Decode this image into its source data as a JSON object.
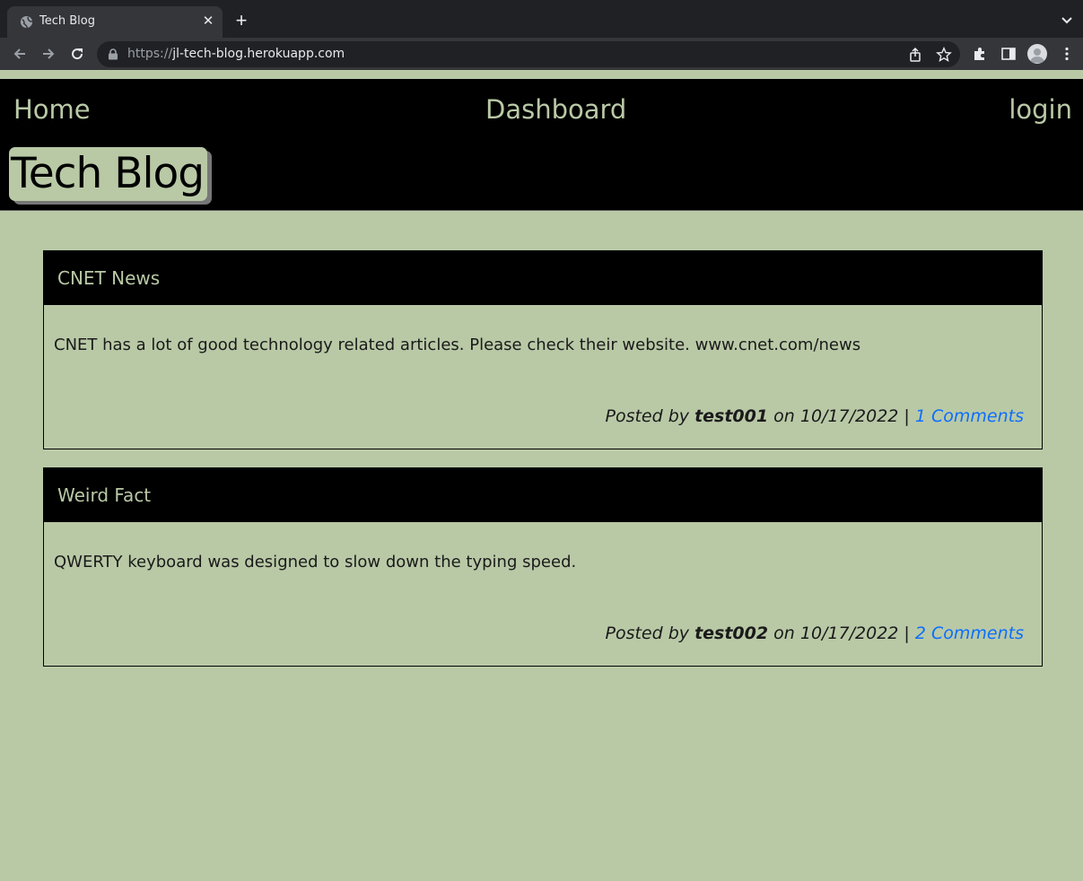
{
  "browser": {
    "tab_title": "Tech Blog",
    "url_scheme": "https://",
    "url_host": "jl-tech-blog.herokuapp.com"
  },
  "site": {
    "nav": {
      "home": "Home",
      "dashboard": "Dashboard",
      "login": "login"
    },
    "brand": "Tech Blog",
    "colors": {
      "accent": "#b9c9a6",
      "header_bg": "#000000",
      "link": "#0d6efd"
    }
  },
  "posts": [
    {
      "title": "CNET News",
      "body": "CNET has a lot of good technology related articles. Please check their website. www.cnet.com/news",
      "posted_by_label": "Posted by",
      "author": "test001",
      "on_label": "on",
      "date": "10/17/2022",
      "separator": "|",
      "comments": "1 Comments"
    },
    {
      "title": "Weird Fact",
      "body": "QWERTY keyboard was designed to slow down the typing speed.",
      "posted_by_label": "Posted by",
      "author": "test002",
      "on_label": "on",
      "date": "10/17/2022",
      "separator": "|",
      "comments": "2 Comments"
    }
  ]
}
